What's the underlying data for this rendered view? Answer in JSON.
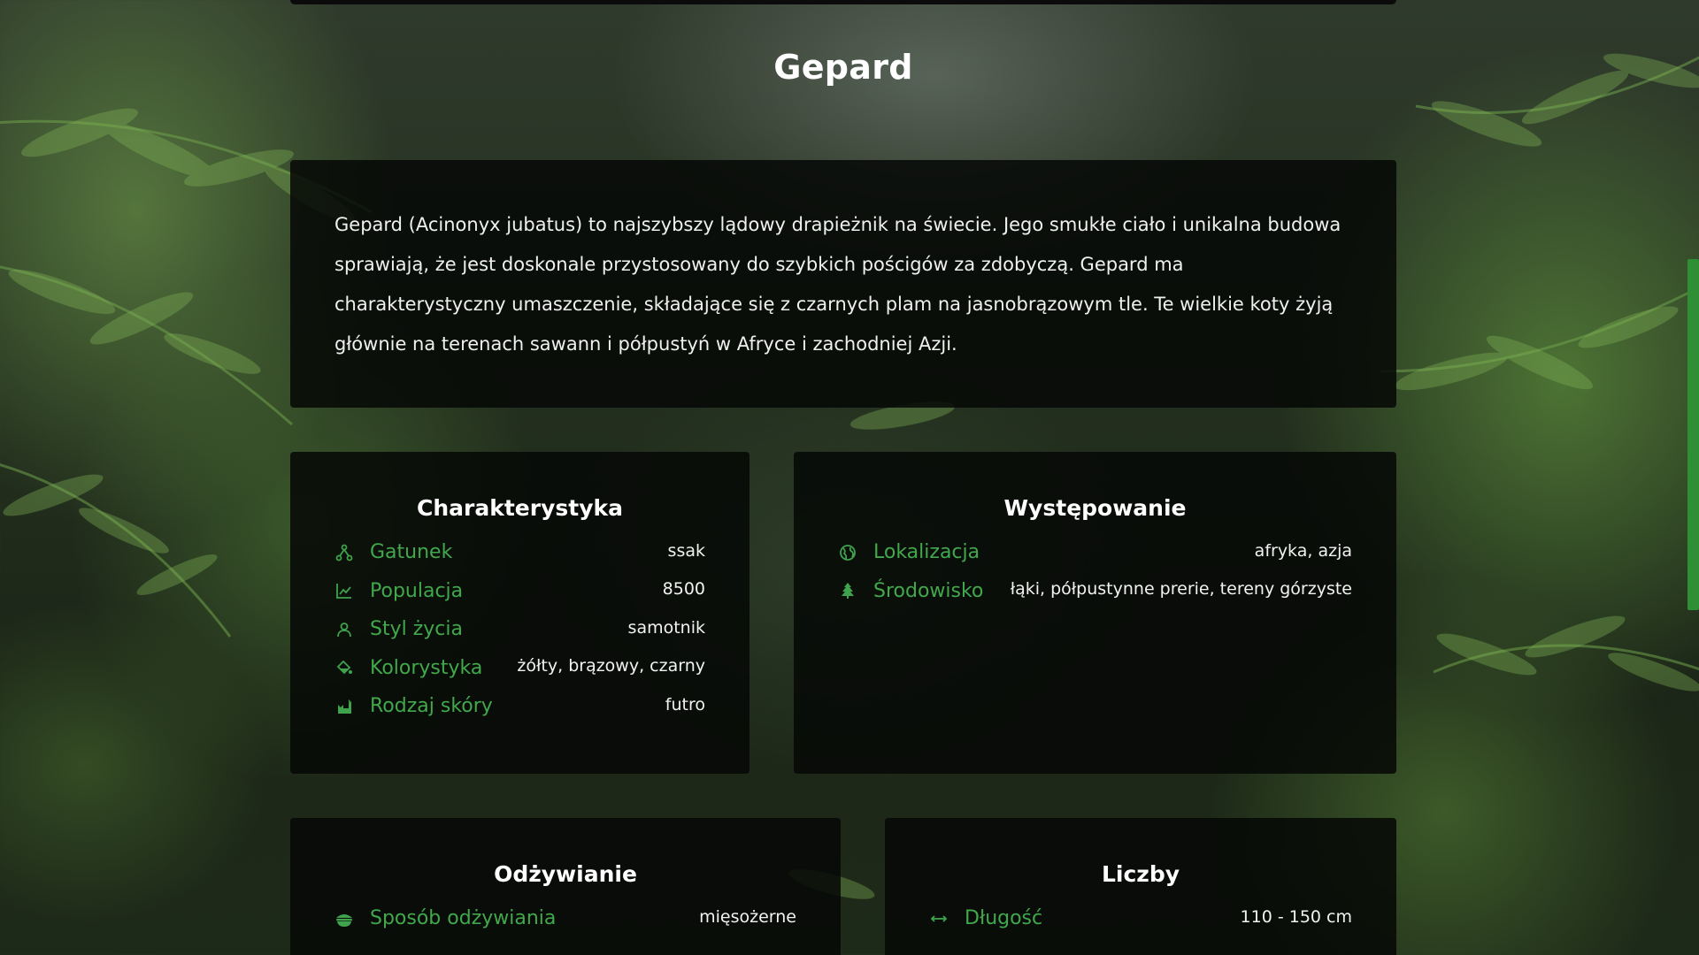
{
  "page": {
    "title": "Gepard",
    "description": "Gepard (Acinonyx jubatus) to najszybszy lądowy drapieżnik na świecie. Jego smukłe ciało i unikalna budowa sprawiają, że jest doskonale przystosowany do szybkich pościgów za zdobyczą. Gepard ma charakterystyczny umaszczenie, składające się z czarnych plam na jasnobrązowym tle. Te wielkie koty żyją głównie na terenach sawann i półpustyń w Afryce i zachodniej Azji."
  },
  "colors": {
    "accent": "#41a84b",
    "card_bg": "#060806",
    "scrollbar": "#2e8f34"
  },
  "characteristics": {
    "title": "Charakterystyka",
    "rows": [
      {
        "icon": "species-icon",
        "label": "Gatunek",
        "value": "ssak"
      },
      {
        "icon": "chart-line-icon",
        "label": "Populacja",
        "value": "8500"
      },
      {
        "icon": "user-icon",
        "label": "Styl życia",
        "value": "samotnik"
      },
      {
        "icon": "paint-bucket-icon",
        "label": "Kolorystyka",
        "value": "żółty, brązowy, czarny"
      },
      {
        "icon": "cat-icon",
        "label": "Rodzaj skóry",
        "value": "futro"
      }
    ]
  },
  "occurrence": {
    "title": "Występowanie",
    "rows": [
      {
        "icon": "globe-icon",
        "label": "Lokalizacja",
        "value": "afryka, azja"
      },
      {
        "icon": "tree-icon",
        "label": "Środowisko",
        "value": "łąki, półpustynne prerie, tereny górzyste"
      }
    ]
  },
  "nutrition": {
    "title": "Odżywianie",
    "rows": [
      {
        "icon": "bowl-icon",
        "label": "Sposób odżywiania",
        "value": "mięsożerne"
      }
    ]
  },
  "numbers": {
    "title": "Liczby",
    "rows": [
      {
        "icon": "arrows-horizontal-icon",
        "label": "Długość",
        "value": "110 - 150 cm"
      }
    ]
  }
}
